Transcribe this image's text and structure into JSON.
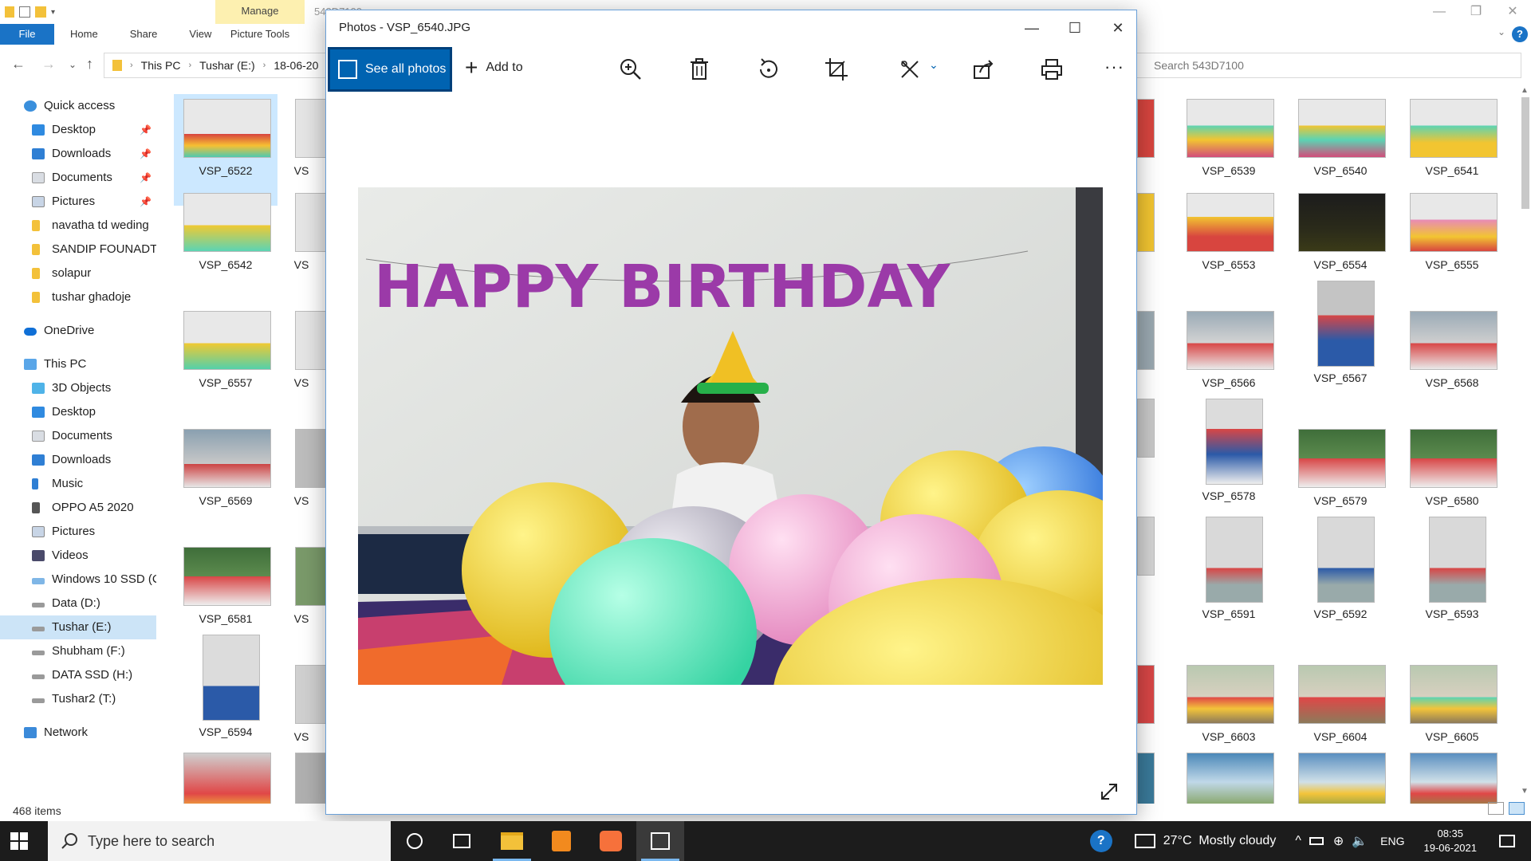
{
  "explorer": {
    "window_title": "543D7100",
    "manage_tab": "Manage",
    "ribbon_tabs": {
      "file": "File",
      "home": "Home",
      "share": "Share",
      "view": "View",
      "picture_tools": "Picture Tools"
    },
    "breadcrumb": [
      "This PC",
      "Tushar (E:)",
      "18-06-20"
    ],
    "search_placeholder": "Search 543D7100",
    "status": "468 items",
    "nav": {
      "quick_access": "Quick access",
      "quick_items": [
        "Desktop",
        "Downloads",
        "Documents",
        "Pictures",
        "navatha td weding",
        "SANDIP FOUNADTI(",
        "solapur",
        "tushar ghadoje"
      ],
      "onedrive": "OneDrive",
      "this_pc": "This PC",
      "pc_items": [
        "3D Objects",
        "Desktop",
        "Documents",
        "Downloads",
        "Music",
        "OPPO A5 2020",
        "Pictures",
        "Videos",
        "Windows 10 SSD (C",
        "Data (D:)",
        "Tushar (E:)",
        "Shubham (F:)",
        "DATA SSD (H:)",
        "Tushar2 (T:)"
      ],
      "network": "Network"
    },
    "thumbnails_left": [
      [
        "VSP_6522",
        "VS"
      ],
      [
        "VSP_6542",
        "VS"
      ],
      [
        "VSP_6557",
        "VS"
      ],
      [
        "VSP_6569",
        "VS"
      ],
      [
        "VSP_6581",
        "VS"
      ],
      [
        "VSP_6594",
        "VS"
      ]
    ],
    "thumbnails_right": [
      [
        "38",
        "VSP_6539",
        "VSP_6540",
        "VSP_6541"
      ],
      [
        "52",
        "VSP_6553",
        "VSP_6554",
        "VSP_6555"
      ],
      [
        "65",
        "VSP_6566",
        "VSP_6567",
        "VSP_6568"
      ],
      [
        "77",
        "VSP_6578",
        "VSP_6579",
        "VSP_6580"
      ],
      [
        "90",
        "VSP_6591",
        "VSP_6592",
        "VSP_6593"
      ],
      [
        "02",
        "VSP_6603",
        "VSP_6604",
        "VSP_6605"
      ]
    ]
  },
  "photos": {
    "title": "Photos - VSP_6540.JPG",
    "see_all": "See all photos",
    "add_to": "Add to",
    "banner_text": "HAPPY BIRTHDAY"
  },
  "taskbar": {
    "search_placeholder": "Type here to search",
    "weather": "27°C  Mostly cloudy",
    "lang": "ENG",
    "time": "08:35",
    "date": "19-06-2021"
  },
  "colors": {
    "accent": "#0063b1",
    "file_tab": "#1a73c6",
    "manage_tab_bg": "#fdf0b0",
    "selection": "#cce8ff"
  }
}
